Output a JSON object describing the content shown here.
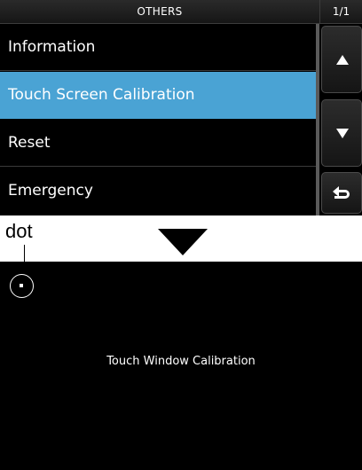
{
  "menu_screen": {
    "title": "OTHERS",
    "page_indicator": "1/1",
    "items": [
      {
        "label": "Information",
        "selected": false
      },
      {
        "label": "Touch Screen Calibration",
        "selected": true
      },
      {
        "label": "Reset",
        "selected": false
      },
      {
        "label": "Emergency",
        "selected": false
      }
    ],
    "selected_color": "#4aa3d4",
    "side_buttons": {
      "up_icon": "up-triangle-icon",
      "down_icon": "down-triangle-icon",
      "back_icon": "return-arrow-icon"
    }
  },
  "callout": {
    "label": "dot"
  },
  "calibration_screen": {
    "message": "Touch Window Calibration"
  }
}
